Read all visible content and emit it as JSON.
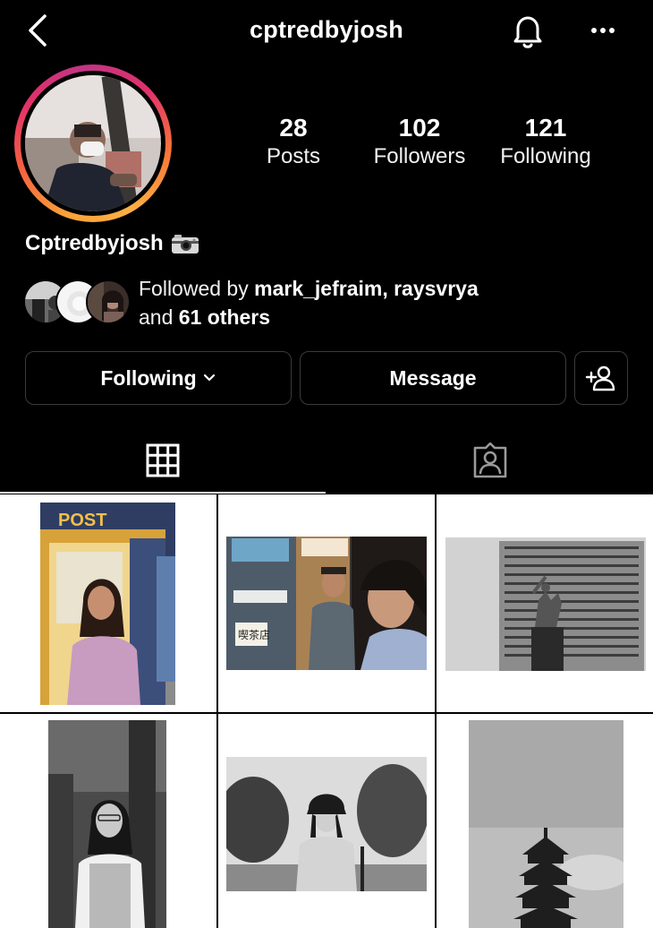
{
  "header": {
    "username": "cptredbyjosh",
    "back_icon": "chevron-left-icon",
    "bell_icon": "bell-icon",
    "more_icon": "more-horizontal-icon"
  },
  "profile": {
    "stats": [
      {
        "value": "28",
        "label": "Posts"
      },
      {
        "value": "102",
        "label": "Followers"
      },
      {
        "value": "121",
        "label": "Following"
      }
    ],
    "display_name": "Cptredbyjosh",
    "display_name_icon": "camera-icon",
    "followed_by": {
      "prefix": "Followed by ",
      "user1": "mark_jefraim",
      "sep": ", ",
      "user2": "raysvrya",
      "and": "and ",
      "others": "61 others"
    }
  },
  "actions": {
    "following_label": "Following",
    "message_label": "Message",
    "add_user_icon": "add-user-icon"
  },
  "tabs": [
    {
      "icon": "grid-icon",
      "active": true
    },
    {
      "icon": "tagged-icon",
      "active": false
    }
  ],
  "colors": {
    "background": "#000000",
    "text": "#ffffff",
    "border": "#3a3a3a",
    "story_ring": [
      "#fcaf45",
      "#f56040",
      "#e1306c",
      "#c13584"
    ]
  }
}
